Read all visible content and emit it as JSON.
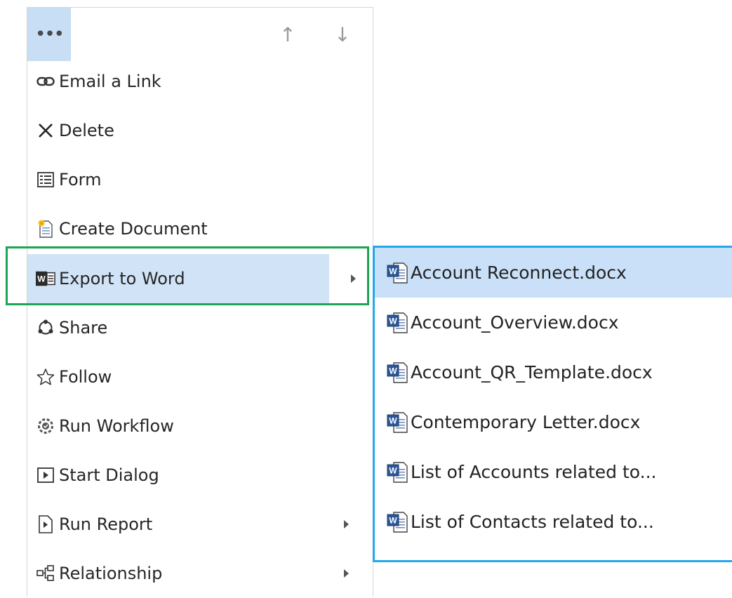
{
  "menu": {
    "more_glyph": "•••",
    "up_glyph": "↑",
    "down_glyph": "↓",
    "items": [
      {
        "label": "Email a Link",
        "icon": "link-icon"
      },
      {
        "label": "Delete",
        "icon": "delete-x-icon"
      },
      {
        "label": "Form",
        "icon": "form-icon"
      },
      {
        "label": "Create Document",
        "icon": "create-document-icon"
      },
      {
        "label": "Export to Word",
        "icon": "word-export-icon",
        "has_submenu": true,
        "selected": true
      },
      {
        "label": "Share",
        "icon": "share-icon"
      },
      {
        "label": "Follow",
        "icon": "star-icon"
      },
      {
        "label": "Run Workflow",
        "icon": "workflow-icon"
      },
      {
        "label": "Start Dialog",
        "icon": "dialog-play-icon"
      },
      {
        "label": "Run Report",
        "icon": "report-icon",
        "has_submenu": true
      },
      {
        "label": "Relationship",
        "icon": "relationship-icon",
        "has_submenu": true
      }
    ]
  },
  "submenu": {
    "items": [
      {
        "label": "Account Reconnect.docx",
        "icon": "word-document-icon",
        "selected": true
      },
      {
        "label": "Account_Overview.docx",
        "icon": "word-document-icon"
      },
      {
        "label": "Account_QR_Template.docx",
        "icon": "word-document-icon"
      },
      {
        "label": "Contemporary Letter.docx",
        "icon": "word-document-icon"
      },
      {
        "label": "List of Accounts related to...",
        "icon": "word-document-icon"
      },
      {
        "label": "List of Contacts related to...",
        "icon": "word-document-icon"
      }
    ]
  },
  "colors": {
    "selected_bg": "#d1e3f7",
    "green_highlight": "#1ca552",
    "blue_highlight": "#23a8ec"
  }
}
